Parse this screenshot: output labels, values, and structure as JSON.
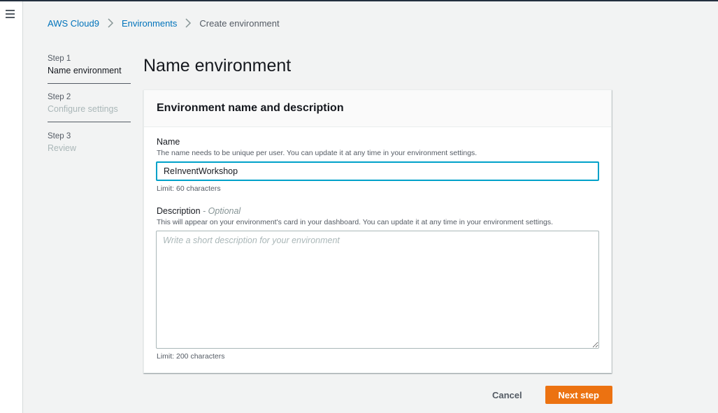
{
  "breadcrumb": {
    "items": [
      "AWS Cloud9",
      "Environments"
    ],
    "current": "Create environment"
  },
  "steps": [
    {
      "number": "Step 1",
      "title": "Name environment",
      "state": "active"
    },
    {
      "number": "Step 2",
      "title": "Configure settings",
      "state": "inactive"
    },
    {
      "number": "Step 3",
      "title": "Review",
      "state": "inactive"
    }
  ],
  "page": {
    "title": "Name environment"
  },
  "panel": {
    "title": "Environment name and description",
    "name": {
      "label": "Name",
      "description": "The name needs to be unique per user. You can update it at any time in your environment settings.",
      "value": "ReInventWorkshop",
      "limit": "Limit: 60 characters"
    },
    "description": {
      "label": "Description",
      "optional": "- Optional",
      "description": "This will appear on your environment's card in your dashboard. You can update it at any time in your environment settings.",
      "placeholder": "Write a short description for your environment",
      "value": "",
      "limit": "Limit: 200 characters"
    }
  },
  "actions": {
    "cancel_label": "Cancel",
    "next_label": "Next step"
  },
  "colors": {
    "link": "#0073bb",
    "primary_button": "#ec7211",
    "focus_border": "#00a1c9"
  }
}
